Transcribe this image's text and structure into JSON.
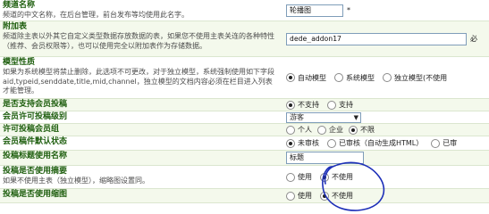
{
  "rows": [
    {
      "title": "频道名称",
      "desc": "频道的中文名称，在后台管理，前台发布等均使用此名字。",
      "input": "轮播图",
      "suffix": "*"
    },
    {
      "title": "附加表",
      "desc": "频道除主表以外其它自定义类型数据存放数据的表，如果您不使用主表关连的各种特性（推荐、会员权限等），也可以使用完全以附加表作为存储数据。",
      "input": "dede_addon17",
      "suffix": "必"
    },
    {
      "title": "模型性质",
      "desc": "如果为系统模型将禁止删除，此选项不可更改，对于独立模型，系统强制使用如下字段aid,typeid,senddate,title,mid,channel，独立模型的文档内容必须在栏目进入列表才能管理。",
      "options": [
        {
          "label": "自动模型",
          "checked": true
        },
        {
          "label": "系统模型",
          "checked": false
        },
        {
          "label": "独立模型(不使用",
          "checked": false
        }
      ]
    },
    {
      "title": "是否支持会员投稿",
      "options": [
        {
          "label": "不支持",
          "checked": true
        },
        {
          "label": "支持",
          "checked": false
        }
      ]
    },
    {
      "title": "会员许可投稿级别",
      "select": "游客"
    },
    {
      "title": "许可投稿会员组",
      "options": [
        {
          "label": "个人",
          "checked": false
        },
        {
          "label": "企业",
          "checked": false
        },
        {
          "label": "不限",
          "checked": true
        }
      ]
    },
    {
      "title": "会员稿件默认状态",
      "options": [
        {
          "label": "未审核",
          "checked": true
        },
        {
          "label": "已审核（自动生成HTML）",
          "checked": false
        },
        {
          "label": "已审",
          "checked": false
        }
      ]
    },
    {
      "title": "投稿标题使用名称",
      "input": "标题"
    },
    {
      "title": "投稿是否使用摘要",
      "desc": "如果不使用主表（独立模型），缩略图设置同。",
      "options": [
        {
          "label": "使用",
          "checked": false
        },
        {
          "label": "不使用",
          "checked": true
        }
      ]
    },
    {
      "title": "投稿是否使用缩图",
      "options": [
        {
          "label": "使用",
          "checked": false
        },
        {
          "label": "不使用",
          "checked": true
        }
      ]
    }
  ],
  "colors": {
    "title_green": "#1f5f0f",
    "row_shade": "#f4f9ec",
    "row_border": "#dbe6cf",
    "annotation_blue": "#1d2fb8"
  }
}
